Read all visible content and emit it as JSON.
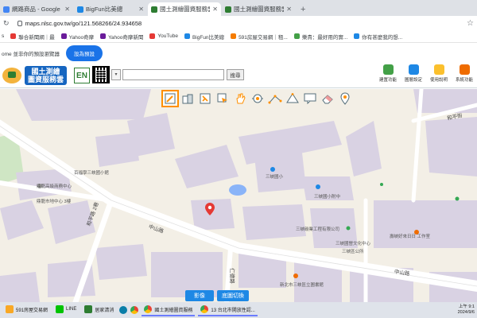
{
  "browser": {
    "tabs": [
      {
        "title": "網路商品 - Google",
        "color": "#4285f4",
        "active": false
      },
      {
        "title": "BigFun比美總",
        "color": "#1e88e5",
        "active": false
      },
      {
        "title": "國土測繪圖資服務雲",
        "color": "#2e7d32",
        "active": true
      },
      {
        "title": "國土測繪圖資服務雲",
        "color": "#2e7d32",
        "active": false
      }
    ],
    "new_tab_symbol": "+",
    "url": "maps.nlsc.gov.tw/go/121.568266/24.934658",
    "star_symbol": "☆"
  },
  "bookmarks": [
    {
      "label": "s",
      "color": "#9e9e9e"
    },
    {
      "label": "聯合新聞網｜最",
      "color": "#e53935"
    },
    {
      "label": "Yahoo奇摩",
      "color": "#6a1b9a"
    },
    {
      "label": "Yahoo奇摩新聞",
      "color": "#6a1b9a"
    },
    {
      "label": "YouTube",
      "color": "#e53935"
    },
    {
      "label": "BigFun比美總",
      "color": "#1e88e5"
    },
    {
      "label": "591房屋交易網｜租...",
      "color": "#f57c00"
    },
    {
      "label": "樂貴：最好用的實...",
      "color": "#43a047"
    },
    {
      "label": "你有甚麼我的想...",
      "color": "#1e88e5"
    }
  ],
  "notice": {
    "text": "ome 並非你的預設瀏覽器",
    "button": "設為預設"
  },
  "site": {
    "logo_line1": "國土測繪",
    "logo_line2": "圖資服務雲",
    "en_label": "EN",
    "search_select": "▾",
    "search_placeholder": "",
    "search_button": "搜尋",
    "header_tools": [
      {
        "label": "建置功能",
        "color": "#43a047"
      },
      {
        "label": "圖層設定",
        "color": "#1e88e5"
      },
      {
        "label": "使用說明",
        "color": "#fbc02d"
      },
      {
        "label": "系統功能",
        "color": "#ef6c00"
      }
    ]
  },
  "map": {
    "road_labels": [
      "中山路",
      "中山路",
      "仁德路",
      "和平街",
      "和平路 2巷"
    ],
    "place_labels": [
      "鼎龍高級商務中心",
      "鼎龍市地中心 3樓",
      "百福學三峽國小館",
      "三峽國小",
      "三峽國小操場",
      "三峽國小附中",
      "三峽碳業工程有限公司",
      "三峽茶地文化中心",
      "三峽國營文化中心",
      "壽峽好來日日 工作室",
      "三峽區公所",
      "新北市三峽區立圖書館"
    ],
    "buttons": {
      "imagery": "影像",
      "base_switch": "底圖切換"
    },
    "marker_color": "#e53935",
    "pond_color": "#8ab4f8"
  },
  "map_toolbar": [
    {
      "icon": "pencil-icon",
      "selected": true
    },
    {
      "icon": "building-3d-icon",
      "selected": false
    },
    {
      "icon": "edit-icon",
      "selected": false
    },
    {
      "icon": "pointer-icon",
      "selected": false
    },
    {
      "icon": "hand-pan-icon",
      "selected": false
    },
    {
      "icon": "locate-icon",
      "selected": false
    },
    {
      "icon": "measure-distance-icon",
      "selected": false
    },
    {
      "icon": "measure-area-icon",
      "selected": false
    },
    {
      "icon": "comment-icon",
      "selected": false
    },
    {
      "icon": "eraser-icon",
      "selected": false
    },
    {
      "icon": "pin-location-icon",
      "selected": false
    }
  ],
  "taskbar": {
    "items": [
      {
        "label": "591房屋交易網",
        "color": "#f9a825",
        "active": false
      },
      {
        "label": "LINE",
        "color": "#00c300",
        "active": false
      },
      {
        "label": "居家清消",
        "color": "#2e7d32",
        "active": false
      },
      {
        "label": "國土測繪圖資服務",
        "color": "#1e88e5",
        "active": true
      },
      {
        "label": "13 台北市開放性認...",
        "color": "#e53935",
        "active": true
      }
    ],
    "time": "上午 9:1",
    "date": "2024/9/6"
  }
}
